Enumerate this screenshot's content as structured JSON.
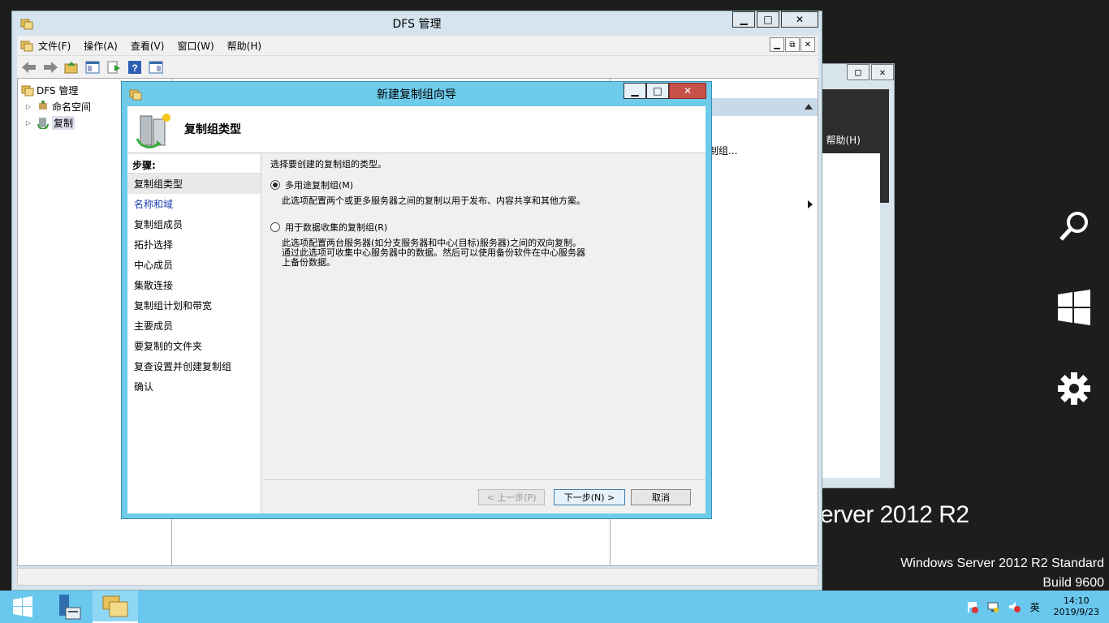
{
  "desktop": {
    "brand_big": "erver 2012 R2",
    "brand_line1": "Windows Server 2012 R2 Standard",
    "brand_line2": "Build 9600",
    "charms": [
      "search-icon",
      "start-icon",
      "settings-icon"
    ]
  },
  "bg_window": {
    "help_menu": ")   帮助(H)",
    "caps": [
      "□",
      "✕"
    ]
  },
  "mmc": {
    "title": "DFS 管理",
    "caps": [
      "▁",
      "□",
      "✕"
    ],
    "menu": [
      "文件(F)",
      "操作(A)",
      "查看(V)",
      "窗口(W)",
      "帮助(H)"
    ],
    "mdi_caps": [
      "▁",
      "⧉",
      "✕"
    ],
    "tree": {
      "root": "DFS 管理",
      "children": [
        "命名空间",
        "复制"
      ]
    },
    "actions_item": "制组..."
  },
  "wizard": {
    "title": "新建复制组向导",
    "caps": [
      "▁",
      "□",
      "✕"
    ],
    "header_title": "复制组类型",
    "steps_header": "步骤:",
    "steps": [
      "复制组类型",
      "名称和域",
      "复制组成员",
      "拓扑选择",
      "中心成员",
      "集散连接",
      "复制组计划和带宽",
      "主要成员",
      "要复制的文件夹",
      "复查设置并创建复制组",
      "确认"
    ],
    "lead": "选择要创建的复制组的类型。",
    "option1_label": "多用途复制组(M)",
    "option1_desc": "此选项配置两个或更多服务器之间的复制以用于发布、内容共享和其他方案。",
    "option2_label": "用于数据收集的复制组(R)",
    "option2_desc": "此选项配置两台服务器(如分支服务器和中心(目标)服务器)之间的双向复制。通过此选项可收集中心服务器中的数据。然后可以使用备份软件在中心服务器上备份数据。",
    "selected_option": 1,
    "buttons": {
      "back": "< 上一步(P)",
      "next": "下一步(N) >",
      "cancel": "取消"
    }
  },
  "taskbar": {
    "tray_lang": "英",
    "time": "14:10",
    "date": "2019/9/23"
  }
}
